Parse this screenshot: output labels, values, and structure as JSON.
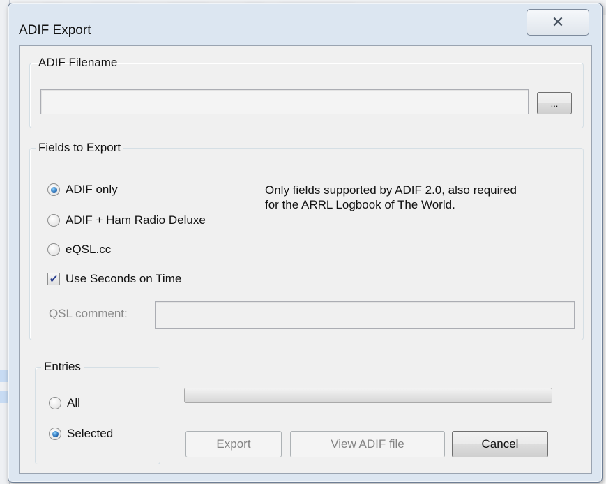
{
  "dialog": {
    "title": "ADIF Export",
    "close_glyph": "✕"
  },
  "filename_group": {
    "legend": "ADIF Filename",
    "filename_value": "",
    "browse_label": "..."
  },
  "fields_group": {
    "legend": "Fields to Export",
    "options": [
      {
        "label": "ADIF only",
        "selected": true
      },
      {
        "label": "ADIF + Ham Radio Deluxe",
        "selected": false
      },
      {
        "label": "eQSL.cc",
        "selected": false
      }
    ],
    "description_line1": "Only fields supported by ADIF 2.0, also required",
    "description_line2": "for the ARRL Logbook of The World.",
    "use_seconds_label": "Use Seconds on Time",
    "use_seconds_checked": true,
    "qsl_comment_label": "QSL comment:",
    "qsl_comment_value": ""
  },
  "entries_group": {
    "legend": "Entries",
    "options": [
      {
        "label": "All",
        "selected": false
      },
      {
        "label": "Selected",
        "selected": true
      }
    ]
  },
  "progress": {
    "value": 0
  },
  "buttons": {
    "export_label": "Export",
    "view_label": "View ADIF file",
    "cancel_label": "Cancel"
  },
  "colors": {
    "dialog_frame": "#dce6f1",
    "client_bg": "#f0f0f0",
    "radio_accent": "#1b5fa8"
  }
}
